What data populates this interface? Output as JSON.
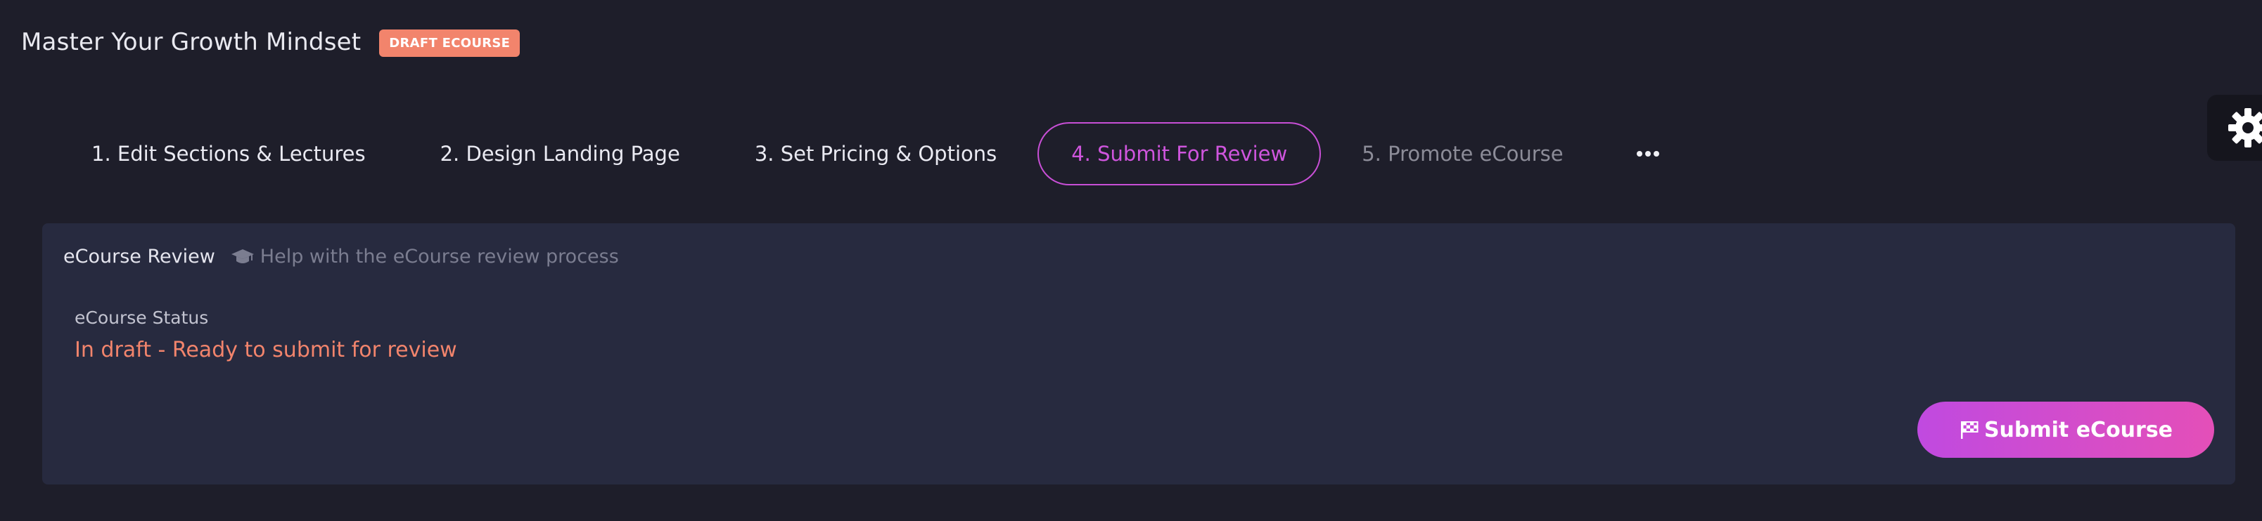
{
  "header": {
    "title": "Master Your Growth Mindset",
    "badge": "DRAFT ECOURSE"
  },
  "steps": [
    {
      "label": "1. Edit Sections & Lectures",
      "state": "normal"
    },
    {
      "label": "2. Design Landing Page",
      "state": "normal"
    },
    {
      "label": "3. Set Pricing & Options",
      "state": "normal"
    },
    {
      "label": "4. Submit For Review",
      "state": "active"
    },
    {
      "label": "5. Promote eCourse",
      "state": "muted"
    }
  ],
  "more_menu_icon": "ellipsis-icon",
  "settings_icon": "gear-icon",
  "panel": {
    "title": "eCourse Review",
    "help_icon": "graduation-cap-icon",
    "help_text": "Help with the eCourse review process",
    "status_label": "eCourse Status",
    "status_value": "In draft - Ready to submit for review",
    "submit_icon": "checkered-flag-icon",
    "submit_label": "Submit eCourse"
  },
  "colors": {
    "background": "#1e1e2a",
    "panel": "#272a3f",
    "accent": "#cf55dd",
    "draft": "#f2846c"
  }
}
